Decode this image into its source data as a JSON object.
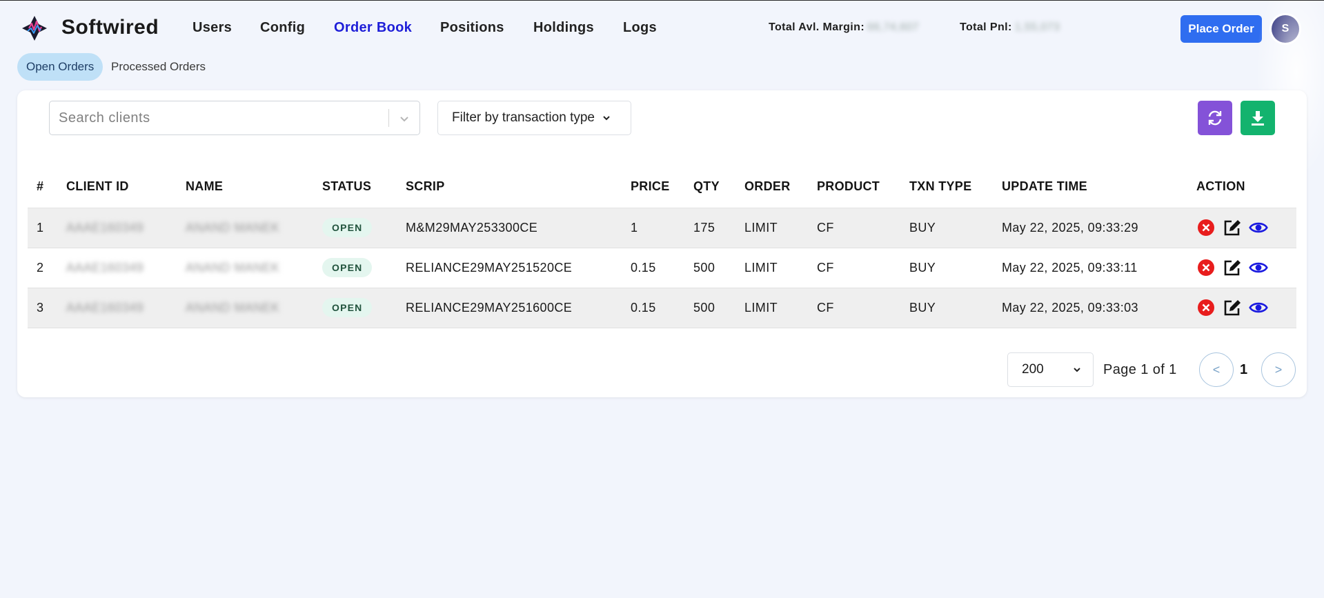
{
  "app": {
    "brand": "Softwired"
  },
  "nav": {
    "items": [
      {
        "label": "Users",
        "active": false
      },
      {
        "label": "Config",
        "active": false
      },
      {
        "label": "Order Book",
        "active": true
      },
      {
        "label": "Positions",
        "active": false
      },
      {
        "label": "Holdings",
        "active": false
      },
      {
        "label": "Logs",
        "active": false
      }
    ]
  },
  "metrics": {
    "margin_label": "Total Avl. Margin:",
    "margin_value": "66,74,607",
    "pnl_label": "Total Pnl:",
    "pnl_value": "1,55,073"
  },
  "header": {
    "place_order_label": "Place Order",
    "avatar_initial": "S"
  },
  "tabs": [
    {
      "label": "Open Orders",
      "active": true
    },
    {
      "label": "Processed Orders",
      "active": false
    }
  ],
  "toolbar": {
    "search_placeholder": "Search clients",
    "filter_label": "Filter by transaction type",
    "refresh_icon": "refresh-icon",
    "download_icon": "download-icon"
  },
  "table": {
    "columns": [
      "#",
      "CLIENT ID",
      "NAME",
      "STATUS",
      "SCRIP",
      "PRICE",
      "QTY",
      "ORDER",
      "PRODUCT",
      "TXN TYPE",
      "UPDATE TIME",
      "ACTION"
    ],
    "rows": [
      {
        "num": "1",
        "client_id": "AAAE160349",
        "name": "ANAND MANEK",
        "status": "OPEN",
        "scrip": "M&M29MAY253300CE",
        "price": "1",
        "qty": "175",
        "order": "LIMIT",
        "product": "CF",
        "txn_type": "BUY",
        "update_time": "May 22, 2025, 09:33:29"
      },
      {
        "num": "2",
        "client_id": "AAAE160349",
        "name": "ANAND MANEK",
        "status": "OPEN",
        "scrip": "RELIANCE29MAY251520CE",
        "price": "0.15",
        "qty": "500",
        "order": "LIMIT",
        "product": "CF",
        "txn_type": "BUY",
        "update_time": "May 22, 2025, 09:33:11"
      },
      {
        "num": "3",
        "client_id": "AAAE160349",
        "name": "ANAND MANEK",
        "status": "OPEN",
        "scrip": "RELIANCE29MAY251600CE",
        "price": "0.15",
        "qty": "500",
        "order": "LIMIT",
        "product": "CF",
        "txn_type": "BUY",
        "update_time": "May 22, 2025, 09:33:03"
      }
    ],
    "row_action_icons": [
      "cancel-icon",
      "edit-icon",
      "view-icon"
    ]
  },
  "pagination": {
    "page_size": "200",
    "page_info": "Page 1 of 1",
    "current_page": "1",
    "prev_label": "<",
    "next_label": ">"
  },
  "colors": {
    "accent_nav": "#1e1ed8",
    "primary_button": "#2f6df0",
    "refresh_button": "#8452d8",
    "download_button": "#13b36e",
    "status_badge_bg": "#e4f6ef",
    "cancel_icon": "#e81d1d",
    "view_icon": "#1a1ae0"
  }
}
